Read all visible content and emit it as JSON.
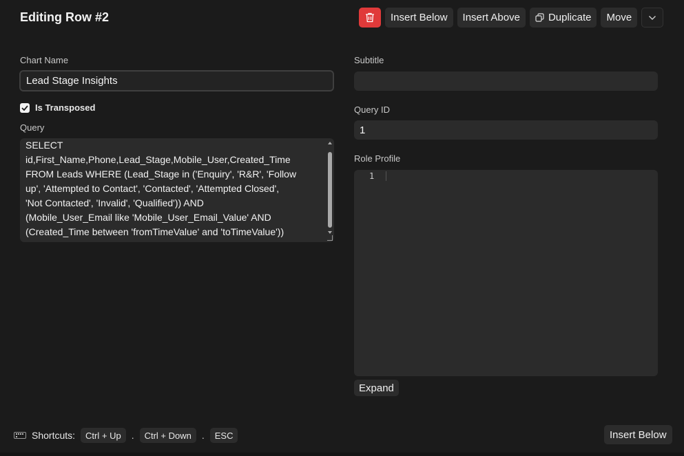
{
  "header": {
    "title": "Editing Row #2",
    "delete_color": "#e03a3a",
    "insert_below": "Insert Below",
    "insert_above": "Insert Above",
    "duplicate": "Duplicate",
    "move": "Move"
  },
  "form": {
    "chart_name_label": "Chart Name",
    "chart_name_value": "Lead Stage Insights",
    "is_transposed_label": "Is Transposed",
    "is_transposed_checked": true,
    "query_label": "Query",
    "query_value": "SELECT\nid,First_Name,Phone,Lead_Stage,Mobile_User,Created_Time\nFROM Leads WHERE (Lead_Stage in ('Enquiry', 'R&R', 'Follow\nup', 'Attempted to Contact', 'Contacted', 'Attempted Closed',\n'Not Contacted', 'Invalid', 'Qualified')) AND\n(Mobile_User_Email like 'Mobile_User_Email_Value' AND\n(Created_Time between 'fromTimeValue' and 'toTimeValue'))",
    "subtitle_label": "Subtitle",
    "subtitle_value": "",
    "query_id_label": "Query ID",
    "query_id_value": "1",
    "role_profile_label": "Role Profile",
    "role_profile_line_number": "1",
    "expand_label": "Expand"
  },
  "footer": {
    "shortcuts_label": "Shortcuts:",
    "keys": [
      "Ctrl + Up",
      "Ctrl + Down",
      "ESC"
    ],
    "separator": ".",
    "insert_below": "Insert Below"
  }
}
